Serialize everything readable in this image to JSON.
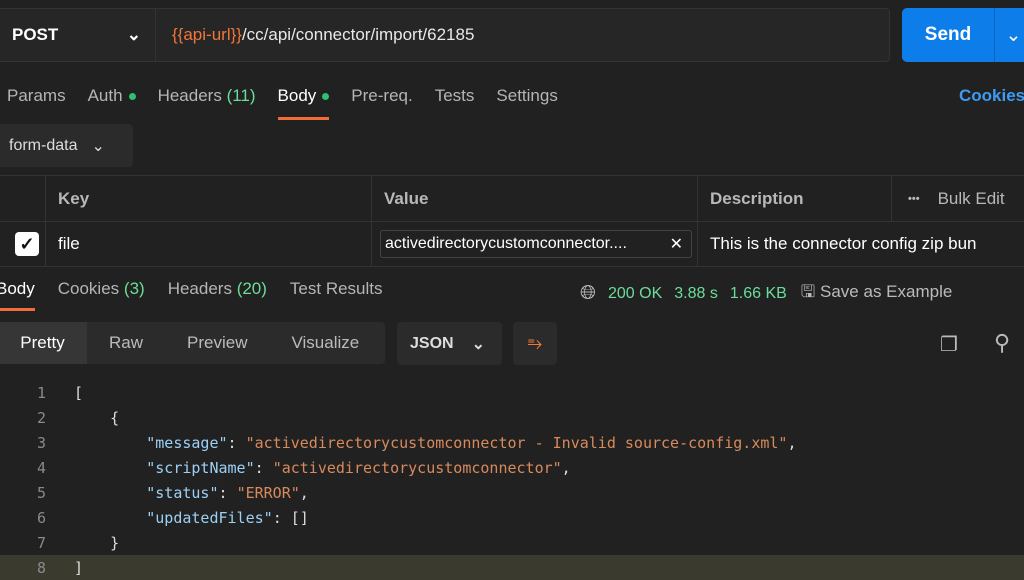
{
  "request": {
    "method": "POST",
    "url_var": "{{api-url}}",
    "url_path": "/cc/api/connector/import/62185",
    "send_label": "Send"
  },
  "tabs": {
    "params": "Params",
    "auth": "Auth",
    "headers": "Headers",
    "headers_count": "(11)",
    "body": "Body",
    "prereq": "Pre-req.",
    "tests": "Tests",
    "settings": "Settings",
    "cookies": "Cookies"
  },
  "body_type": "form-data",
  "table": {
    "headers": {
      "key": "Key",
      "value": "Value",
      "description": "Description",
      "bulk": "Bulk Edit",
      "more": "•••"
    },
    "rows": [
      {
        "checked": true,
        "key": "file",
        "value": "activedirectorycustomconnector....",
        "description": "This is the connector config zip bun"
      }
    ]
  },
  "response": {
    "tabs": {
      "body": "Body",
      "cookies": "Cookies",
      "cookies_count": "(3)",
      "headers": "Headers",
      "headers_count": "(20)",
      "tests": "Test Results"
    },
    "status": "200 OK",
    "time": "3.88 s",
    "size": "1.66 KB",
    "save": "Save as Example",
    "views": [
      "Pretty",
      "Raw",
      "Preview",
      "Visualize"
    ],
    "format": "JSON",
    "lines": [
      {
        "n": "1",
        "parts": [
          [
            "p",
            "["
          ]
        ]
      },
      {
        "n": "2",
        "parts": [
          [
            "p",
            "    {"
          ]
        ]
      },
      {
        "n": "3",
        "parts": [
          [
            "p",
            "        "
          ],
          [
            "k",
            "\"message\""
          ],
          [
            "p",
            ": "
          ],
          [
            "s",
            "\"activedirectorycustomconnector - Invalid source-config.xml\""
          ],
          [
            "p",
            ","
          ]
        ]
      },
      {
        "n": "4",
        "parts": [
          [
            "p",
            "        "
          ],
          [
            "k",
            "\"scriptName\""
          ],
          [
            "p",
            ": "
          ],
          [
            "s",
            "\"activedirectorycustomconnector\""
          ],
          [
            "p",
            ","
          ]
        ]
      },
      {
        "n": "5",
        "parts": [
          [
            "p",
            "        "
          ],
          [
            "k",
            "\"status\""
          ],
          [
            "p",
            ": "
          ],
          [
            "s",
            "\"ERROR\""
          ],
          [
            "p",
            ","
          ]
        ]
      },
      {
        "n": "6",
        "parts": [
          [
            "p",
            "        "
          ],
          [
            "k",
            "\"updatedFiles\""
          ],
          [
            "p",
            ": []"
          ]
        ]
      },
      {
        "n": "7",
        "parts": [
          [
            "p",
            "    }"
          ]
        ]
      },
      {
        "n": "8",
        "parts": [
          [
            "p",
            "]"
          ]
        ]
      }
    ]
  }
}
